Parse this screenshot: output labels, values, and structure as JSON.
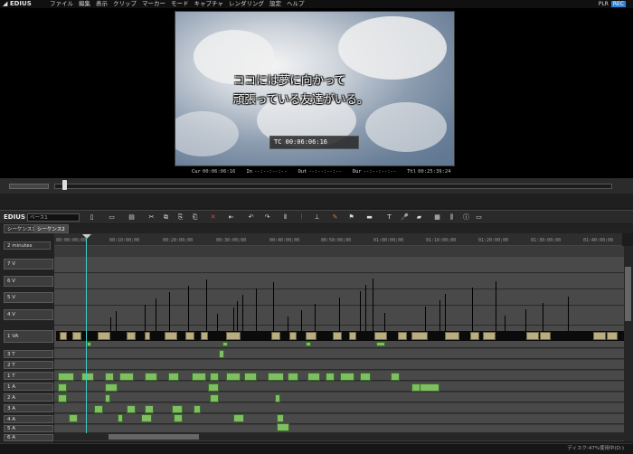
{
  "app": {
    "name": "EDIUS"
  },
  "menu": [
    "ファイル",
    "編集",
    "表示",
    "クリップ",
    "マーカー",
    "モード",
    "キャプチャ",
    "レンダリング",
    "設定",
    "ヘルプ"
  ],
  "mode": {
    "plr": "PLR",
    "rec": "REC"
  },
  "preview": {
    "subtitle_line1": "ココには夢に向かって",
    "subtitle_line2": "頑張っている友達がいる。",
    "timecode_overlay": "TC 00:06:06:16"
  },
  "timecodes": {
    "cur_label": "Cur",
    "cur": "00:06:06:16",
    "in_label": "In",
    "in": "--:--:--:--",
    "out_label": "Out",
    "out": "--:--:--:--",
    "dur_label": "Dur",
    "dur": "--:--:--:--",
    "ttl_label": "Ttl",
    "ttl": "00:25:39:24"
  },
  "timeline": {
    "header": "EDIUS",
    "base_label": "ベース1",
    "sequence_tabs": [
      "シーケンス1",
      "シーケンス2"
    ],
    "zoom": "2 minutes",
    "ruler_ticks": [
      "00:00:00;00",
      "00:10:00;00",
      "00:20:00;00",
      "00:30:00;00",
      "00:40:00;00",
      "00:50:00;00",
      "01:00:00;00",
      "01:10:00;00",
      "01:20:00;00",
      "01:30:00;00",
      "01:40:00;00"
    ],
    "tracks": [
      "7 V",
      "6 V",
      "5 V",
      "4 V",
      "1 VA",
      "3 T",
      "2 T",
      "1 T",
      "1 A",
      "2 A",
      "3 A",
      "4 A",
      "5 A",
      "6 A"
    ]
  },
  "status": {
    "disk": "ディスク:47%使用中(D:)"
  },
  "colors": {
    "video_clip": "#b8ae82",
    "audio_clip": "#7fbf62",
    "playhead": "#3cd0c8",
    "rec_accent": "#2f7fd0"
  }
}
